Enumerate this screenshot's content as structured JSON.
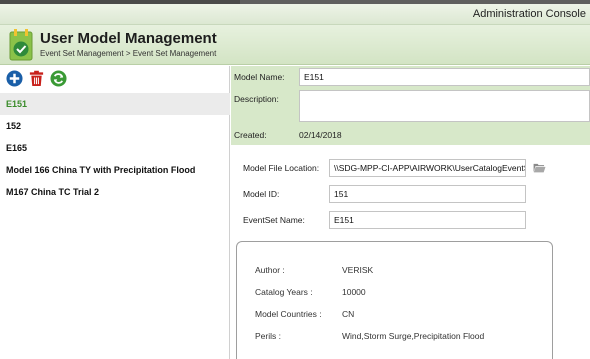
{
  "window": {
    "title": "Administration Console"
  },
  "header": {
    "title": "User Model Management",
    "breadcrumb": "Event Set Management > Event Set Management"
  },
  "toolbar": {
    "add_icon": "add-circle-icon",
    "delete_icon": "trash-icon",
    "refresh_icon": "refresh-icon"
  },
  "models": [
    {
      "name": "E151",
      "selected": true
    },
    {
      "name": "152"
    },
    {
      "name": "E165"
    },
    {
      "name": "Model 166 China TY with Precipitation Flood"
    },
    {
      "name": "M167 China TC Trial 2"
    }
  ],
  "details": {
    "model_name_label": "Model Name:",
    "model_name_value": "E151",
    "description_label": "Description:",
    "description_value": "",
    "created_label": "Created:",
    "created_value": "02/14/2018",
    "file_location_label": "Model File Location:",
    "file_location_value": "\\\\SDG-MPP-CI-APP\\AIRWORK\\UserCatalogEventSe",
    "model_id_label": "Model ID:",
    "model_id_value": "151",
    "eventset_name_label": "EventSet Name:",
    "eventset_name_value": "E151"
  },
  "info": {
    "author_label": "Author :",
    "author_value": "VERISK",
    "catalog_years_label": "Catalog Years :",
    "catalog_years_value": "10000",
    "model_countries_label": "Model Countries :",
    "model_countries_value": "CN",
    "perils_label": "Perils :",
    "perils_value": "Wind,Storm Surge,Precipitation Flood"
  },
  "colors": {
    "accent_green": "#3a8c2a",
    "header_green": "#d7e8c9",
    "add_blue": "#1a5fa8",
    "delete_red": "#c8201b",
    "refresh_green": "#3a9a35"
  }
}
